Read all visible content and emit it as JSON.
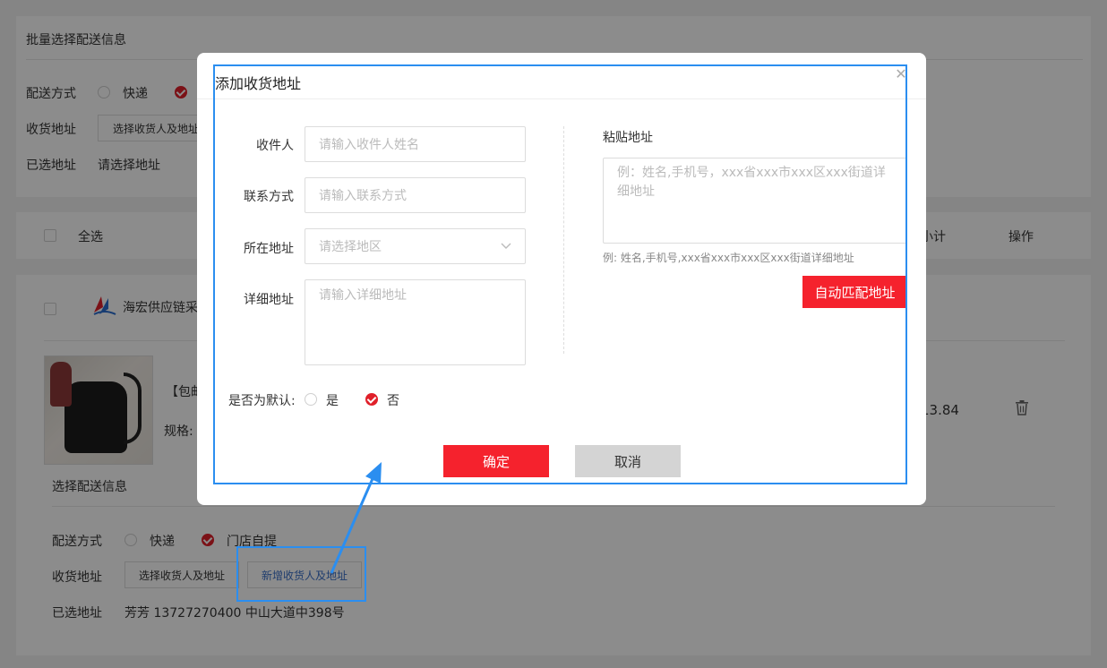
{
  "batch_section": {
    "title": "批量选择配送信息",
    "delivery_label": "配送方式",
    "express_label": "快递",
    "address_label": "收货地址",
    "select_address_button": "选择收货人及地址",
    "selected_label": "已选地址",
    "selected_value": "请选择地址"
  },
  "cart_header": {
    "select_all": "全选",
    "subtotal": "小计",
    "operation": "操作"
  },
  "shop": {
    "name": "海宏供应链采",
    "product_title": "【包邮",
    "spec_prefix": "规格:",
    "subtotal_value": "13.84",
    "delivery_section_title": "选择配送信息",
    "delivery_label": "配送方式",
    "express_label": "快递",
    "pickup_label": "门店自提",
    "address_label": "收货地址",
    "select_address_button": "选择收货人及地址",
    "new_address_button": "新增收货人及地址",
    "selected_label": "已选地址",
    "selected_value": "芳芳 13727270400 中山大道中398号"
  },
  "modal": {
    "title": "添加收货地址",
    "recipient_label": "收件人",
    "recipient_placeholder": "请输入收件人姓名",
    "phone_label": "联系方式",
    "phone_placeholder": "请输入联系方式",
    "region_label": "所在地址",
    "region_placeholder": "请选择地区",
    "detail_label": "详细地址",
    "detail_placeholder": "请输入详细地址",
    "default_label": "是否为默认:",
    "default_yes": "是",
    "default_no": "否",
    "paste_label": "粘贴地址",
    "paste_placeholder": "例：姓名,手机号，xxx省xxx市xxx区xxx街道详细地址",
    "paste_hint": "例: 姓名,手机号,xxx省xxx市xxx区xxx街道详细地址",
    "auto_match_button": "自动匹配地址",
    "confirm_button": "确定",
    "cancel_button": "取消"
  },
  "colors": {
    "accent_red": "#f5222d",
    "highlight_blue": "#2b8ef0"
  }
}
